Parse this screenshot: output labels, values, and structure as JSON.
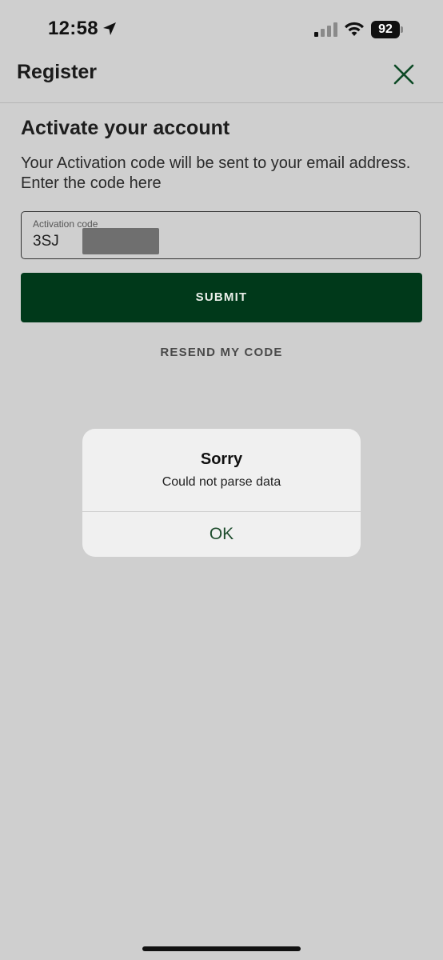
{
  "status_bar": {
    "time": "12:58",
    "battery_level": "92",
    "icons": [
      "location-arrow-icon",
      "cellular-signal-icon",
      "wifi-icon",
      "battery-icon"
    ]
  },
  "header": {
    "title": "Register",
    "close_icon": "close-icon"
  },
  "content": {
    "title": "Activate your account",
    "description": "Your Activation code will be sent to your email address. Enter the code here",
    "activation_field": {
      "label": "Activation code",
      "value": "3SJ"
    },
    "submit_label": "SUBMIT",
    "resend_label": "RESEND MY CODE"
  },
  "alert": {
    "title": "Sorry",
    "message": "Could not parse data",
    "ok_label": "OK"
  },
  "colors": {
    "primary_green": "#00391a",
    "alert_button_green": "#1f4e2e",
    "background_dimmed": "#cfcfcf"
  }
}
